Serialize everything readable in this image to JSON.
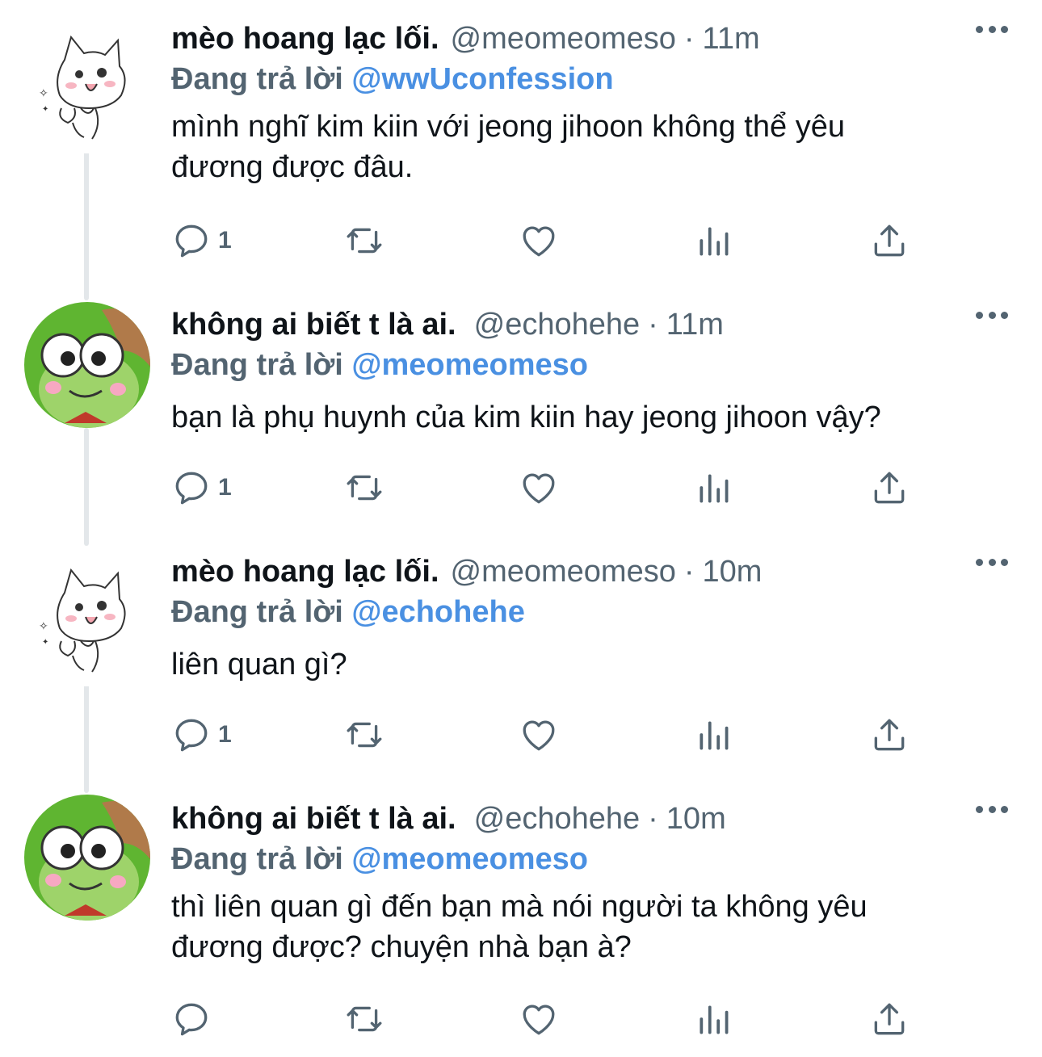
{
  "replying_prefix": "Đang trả lời",
  "tweets": [
    {
      "name": "mèo hoang lạc lối.",
      "handle": "@meomeomeso",
      "dot": "·",
      "time": "11m",
      "replying_to": "@wwUconfession",
      "text_lines": [
        "mình nghĩ kim kiin với jeong jihoon không thể yêu",
        "đương được đâu."
      ],
      "reply_count": "1",
      "avatar": "cat-avatar"
    },
    {
      "name": "không ai biết t là ai.",
      "handle": "@echohehe",
      "dot": "·",
      "time": "11m",
      "replying_to": "@meomeomeso",
      "text_lines": [
        "bạn là phụ huynh của kim kiin hay jeong jihoon vậy?"
      ],
      "reply_count": "1",
      "avatar": "frog-avatar"
    },
    {
      "name": "mèo hoang lạc lối.",
      "handle": "@meomeomeso",
      "dot": "·",
      "time": "10m",
      "replying_to": "@echohehe",
      "text_lines": [
        "liên quan gì?"
      ],
      "reply_count": "1",
      "avatar": "cat-avatar"
    },
    {
      "name": "không ai biết t là ai.",
      "handle": "@echohehe",
      "dot": "·",
      "time": "10m",
      "replying_to": "@meomeomeso",
      "text_lines": [
        "thì liên quan gì đến bạn mà nói người ta không yêu",
        "đương được? chuyện nhà bạn à?"
      ],
      "reply_count": "",
      "avatar": "frog-avatar"
    }
  ],
  "colors": {
    "text": "#0f1419",
    "muted": "#536471",
    "mention": "#4a90e2",
    "thread_line": "#e3e7ea"
  },
  "icons": [
    "reply-icon",
    "retweet-icon",
    "like-icon",
    "views-icon",
    "share-icon",
    "more-icon"
  ]
}
